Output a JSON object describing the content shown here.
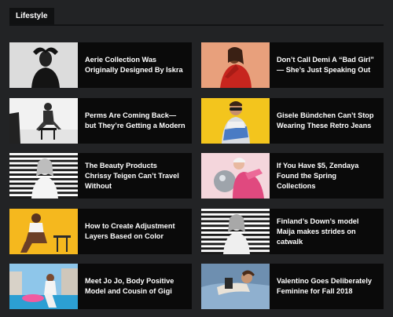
{
  "section": {
    "tab_label": "Lifestyle"
  },
  "articles": [
    {
      "title": "Aerie Collection Was Originally Designed By Iskra",
      "thumb": "woman-in-black-bw-photo"
    },
    {
      "title": "Don’t Call Demi A “Bad Girl” — She’s Just Speaking Out",
      "thumb": "woman-in-red-sweater-photo"
    },
    {
      "title": "Perms Are Coming Back—but They’re Getting a Modern",
      "thumb": "seated-man-bw-photo"
    },
    {
      "title": "Gisele Bündchen Can’t Stop Wearing These Retro Jeans",
      "thumb": "man-on-yellow-background-photo"
    },
    {
      "title": "The Beauty Products Chrissy Teigen Can’t Travel Without",
      "thumb": "woman-with-striped-background-photo"
    },
    {
      "title": "If You Have $5, Zendaya Found the Spring Collections",
      "thumb": "woman-with-disco-ball-photo"
    },
    {
      "title": "How to Create Adjustment Layers Based on Color",
      "thumb": "woman-on-yellow-background-photo"
    },
    {
      "title": "Finland’s Down’s model Maija makes strides on catwalk",
      "thumb": "woman-with-striped-background-photo"
    },
    {
      "title": "Meet Jo Jo, Body Positive Model and Cousin of Gigi",
      "thumb": "woman-by-pool-photo"
    },
    {
      "title": "Valentino Goes Deliberately Feminine for Fall 2018",
      "thumb": "person-lying-on-bed-photo"
    }
  ]
}
